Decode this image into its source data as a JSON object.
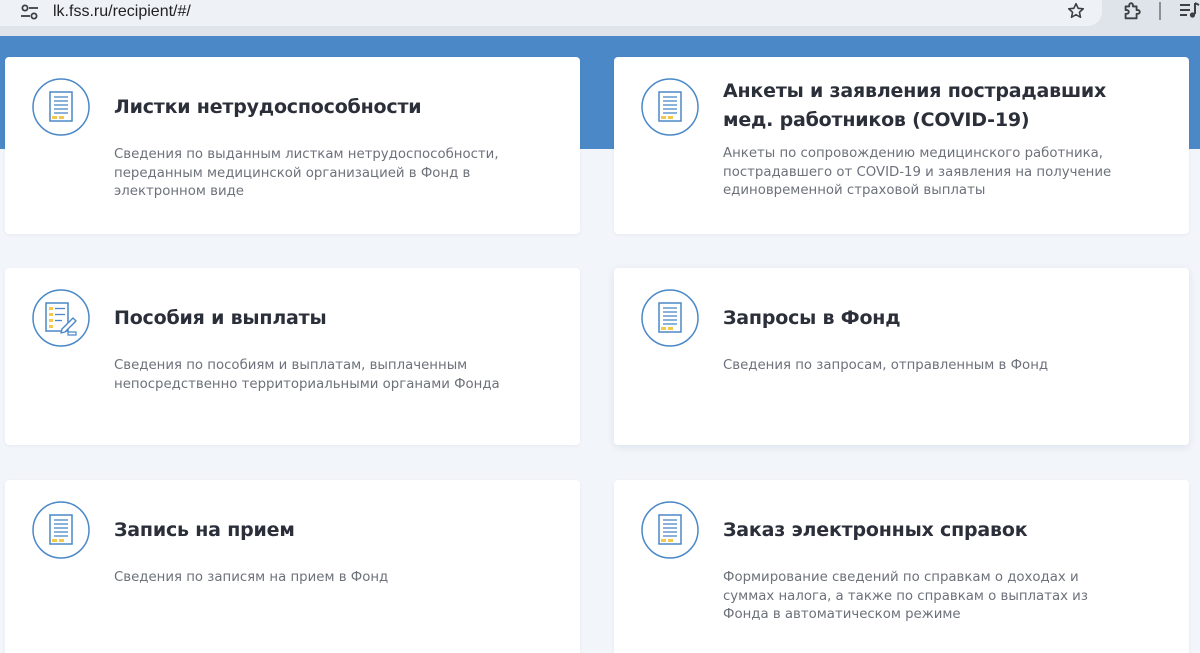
{
  "browser": {
    "url": "lk.fss.ru/recipient/#/",
    "icons": [
      "site-settings-icon",
      "bookmark-star-icon",
      "extensions-puzzle-icon",
      "media-queue-icon"
    ]
  },
  "colors": {
    "band": "#4a88c7",
    "page": "#f2f5fa",
    "icon_stroke": "#4a88c7",
    "icon_accent": "#f2c94c"
  },
  "cards": [
    {
      "title": "Листки нетрудоспособности",
      "desc": "Сведения по выданным листкам нетрудоспособности, переданным медицинской организацией в Фонд в электронном виде",
      "icon": "document-icon"
    },
    {
      "title": "Анкеты и заявления пострадавших мед. работников (COVID-19)",
      "desc": "Анкеты по сопровождению медицинского работника, пострадавшего от COVID-19 и заявления на получение единовременной страховой выплаты",
      "icon": "document-icon"
    },
    {
      "title": "Пособия и выплаты",
      "desc": "Сведения по пособиям и выплатам, выплаченным непосредственно территориальными органами Фонда",
      "icon": "document-pen-icon"
    },
    {
      "title": "Запросы в Фонд",
      "desc": "Сведения по запросам, отправленным в Фонд",
      "icon": "document-icon"
    },
    {
      "title": "Запись на прием",
      "desc": "Сведения по записям на прием в Фонд",
      "icon": "document-icon"
    },
    {
      "title": "Заказ электронных справок",
      "desc": "Формирование сведений по справкам о доходах и суммах налога, а также по справкам о выплатах из Фонда в автоматическом режиме",
      "icon": "document-icon"
    }
  ]
}
